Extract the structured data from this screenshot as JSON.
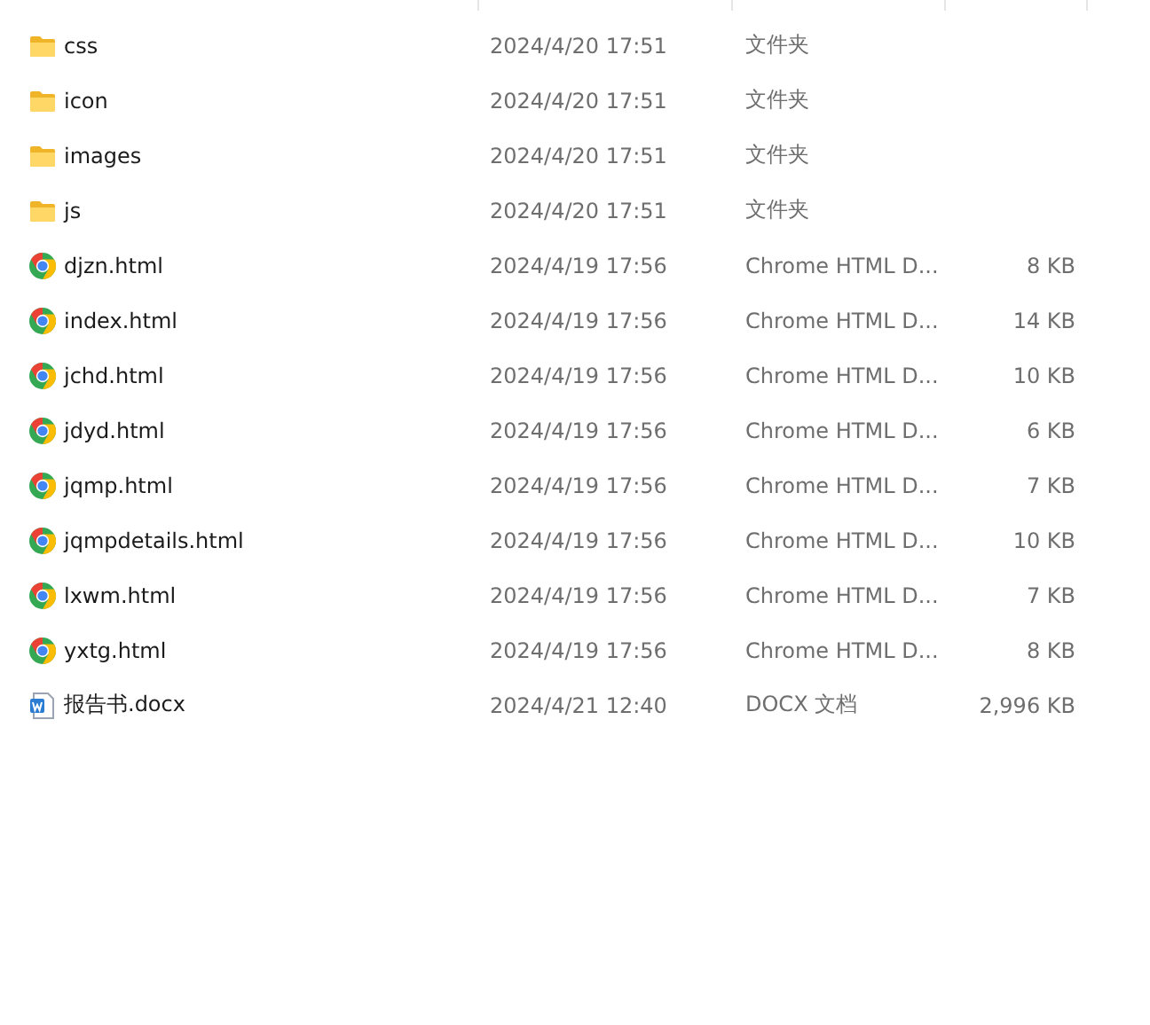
{
  "files": [
    {
      "kind": "folder",
      "name": "css",
      "modified": "2024/4/20 17:51",
      "type": "文件夹"
    },
    {
      "kind": "folder",
      "name": "icon",
      "modified": "2024/4/20 17:51",
      "type": "文件夹"
    },
    {
      "kind": "folder",
      "name": "images",
      "modified": "2024/4/20 17:51",
      "type": "文件夹"
    },
    {
      "kind": "folder",
      "name": "js",
      "modified": "2024/4/20 17:51",
      "type": "文件夹"
    },
    {
      "kind": "chrome",
      "name": "djzn.html",
      "modified": "2024/4/19 17:56",
      "type": "Chrome HTML D...",
      "size": "8 KB"
    },
    {
      "kind": "chrome",
      "name": "index.html",
      "modified": "2024/4/19 17:56",
      "type": "Chrome HTML D...",
      "size": "14 KB"
    },
    {
      "kind": "chrome",
      "name": "jchd.html",
      "modified": "2024/4/19 17:56",
      "type": "Chrome HTML D...",
      "size": "10 KB"
    },
    {
      "kind": "chrome",
      "name": "jdyd.html",
      "modified": "2024/4/19 17:56",
      "type": "Chrome HTML D...",
      "size": "6 KB"
    },
    {
      "kind": "chrome",
      "name": "jqmp.html",
      "modified": "2024/4/19 17:56",
      "type": "Chrome HTML D...",
      "size": "7 KB"
    },
    {
      "kind": "chrome",
      "name": "jqmpdetails.html",
      "modified": "2024/4/19 17:56",
      "type": "Chrome HTML D...",
      "size": "10 KB"
    },
    {
      "kind": "chrome",
      "name": "lxwm.html",
      "modified": "2024/4/19 17:56",
      "type": "Chrome HTML D...",
      "size": "7 KB"
    },
    {
      "kind": "chrome",
      "name": "yxtg.html",
      "modified": "2024/4/19 17:56",
      "type": "Chrome HTML D...",
      "size": "8 KB"
    },
    {
      "kind": "word",
      "name": "报告书.docx",
      "modified": "2024/4/21 12:40",
      "type": "DOCX 文档",
      "size": "2,996 KB"
    }
  ]
}
